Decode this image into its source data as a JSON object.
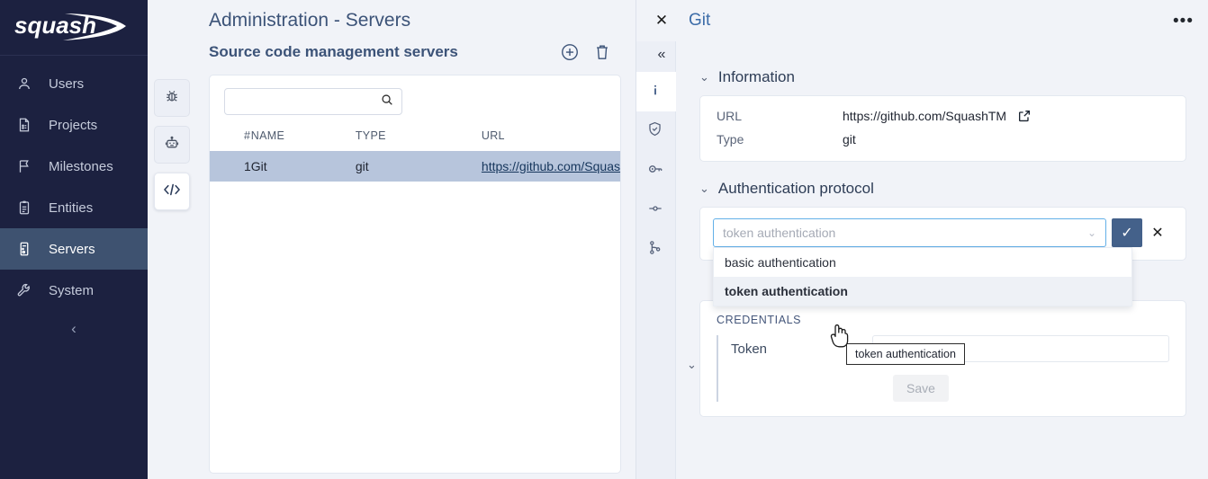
{
  "brand": {
    "name": "squash"
  },
  "sidebar": {
    "items": [
      {
        "label": "Users",
        "icon": "user-icon",
        "active": false
      },
      {
        "label": "Projects",
        "icon": "projects-icon",
        "active": false
      },
      {
        "label": "Milestones",
        "icon": "flag-icon",
        "active": false
      },
      {
        "label": "Entities",
        "icon": "clipboard-icon",
        "active": false
      },
      {
        "label": "Servers",
        "icon": "server-icon",
        "active": true
      },
      {
        "label": "System",
        "icon": "wrench-icon",
        "active": false
      }
    ],
    "collapse_glyph": "‹"
  },
  "rail": {
    "tabs": [
      {
        "icon": "bug-icon",
        "active": false
      },
      {
        "icon": "robot-icon",
        "active": false
      },
      {
        "icon": "code-icon",
        "active": true
      }
    ]
  },
  "main": {
    "page_title": "Administration - Servers",
    "section_title": "Source code management servers",
    "add_label": "add-server",
    "delete_label": "delete-server",
    "search": {
      "value": "",
      "placeholder": ""
    },
    "table": {
      "columns": [
        "#",
        "NAME",
        "TYPE",
        "URL"
      ],
      "rows": [
        {
          "num": "1",
          "name": "Git",
          "type": "git",
          "url": "https://github.com/Squas",
          "selected": true
        }
      ]
    }
  },
  "panel": {
    "title": "Git",
    "close_glyph": "✕",
    "collapse_glyph": "«",
    "more_glyph": "•••",
    "vtabs": [
      {
        "icon": "info-icon",
        "active": true
      },
      {
        "icon": "shield-check-icon",
        "active": false
      },
      {
        "icon": "key-icon",
        "active": false
      },
      {
        "icon": "slider-icon",
        "active": false
      },
      {
        "icon": "git-branch-icon",
        "active": false
      }
    ],
    "information": {
      "heading": "Information",
      "chevron": "⌄",
      "rows": [
        {
          "key": "URL",
          "value": "https://github.com/SquashTM",
          "has_link": true
        },
        {
          "key": "Type",
          "value": "git",
          "has_link": false
        }
      ]
    },
    "auth": {
      "heading": "Authentication protocol",
      "chevron": "⌄",
      "select": {
        "value": "",
        "placeholder": "token authentication",
        "caret": "⌄"
      },
      "confirm_glyph": "✓",
      "cancel_glyph": "✕",
      "options": [
        {
          "label": "basic authentication",
          "selected": false
        },
        {
          "label": "token authentication",
          "selected": true
        }
      ]
    },
    "credentials": {
      "heading": "CREDENTIALS",
      "token_label": "Token",
      "token_value": "",
      "token_placeholder": "",
      "save_label": "Save"
    },
    "tooltip": {
      "text": "token authentication"
    }
  },
  "colors": {
    "nav_bg": "#1c2140",
    "nav_active": "#3e5270",
    "page_bg": "#f1f3f8",
    "accent_blue": "#3c6ca8",
    "confirm_btn": "#44618a",
    "row_selected": "#b7c5dc",
    "focus_border": "#63b0e8"
  }
}
